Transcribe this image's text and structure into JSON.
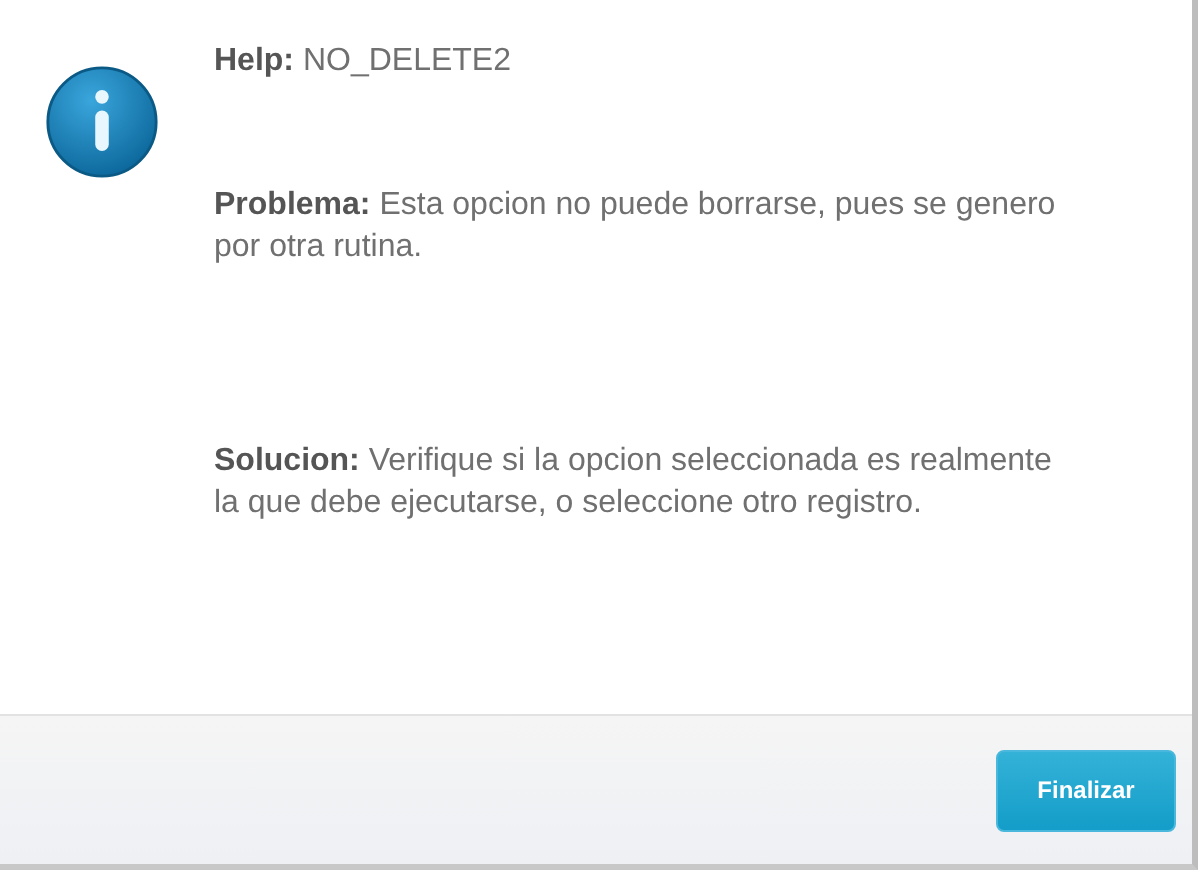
{
  "messages": [
    {
      "text": "**Help:** NO_DELETE2"
    },
    {
      "text": "**Problema:** Esta opcion no puede borrarse, pues se genero por otra rutina."
    },
    {
      "text": "**Solucion:** Verifique si la opcion seleccionada es realmente la que debe ejecutarse, o seleccione otro registro."
    }
  ],
  "buttons": [
    {
      "label": "Finalizar"
    }
  ]
}
